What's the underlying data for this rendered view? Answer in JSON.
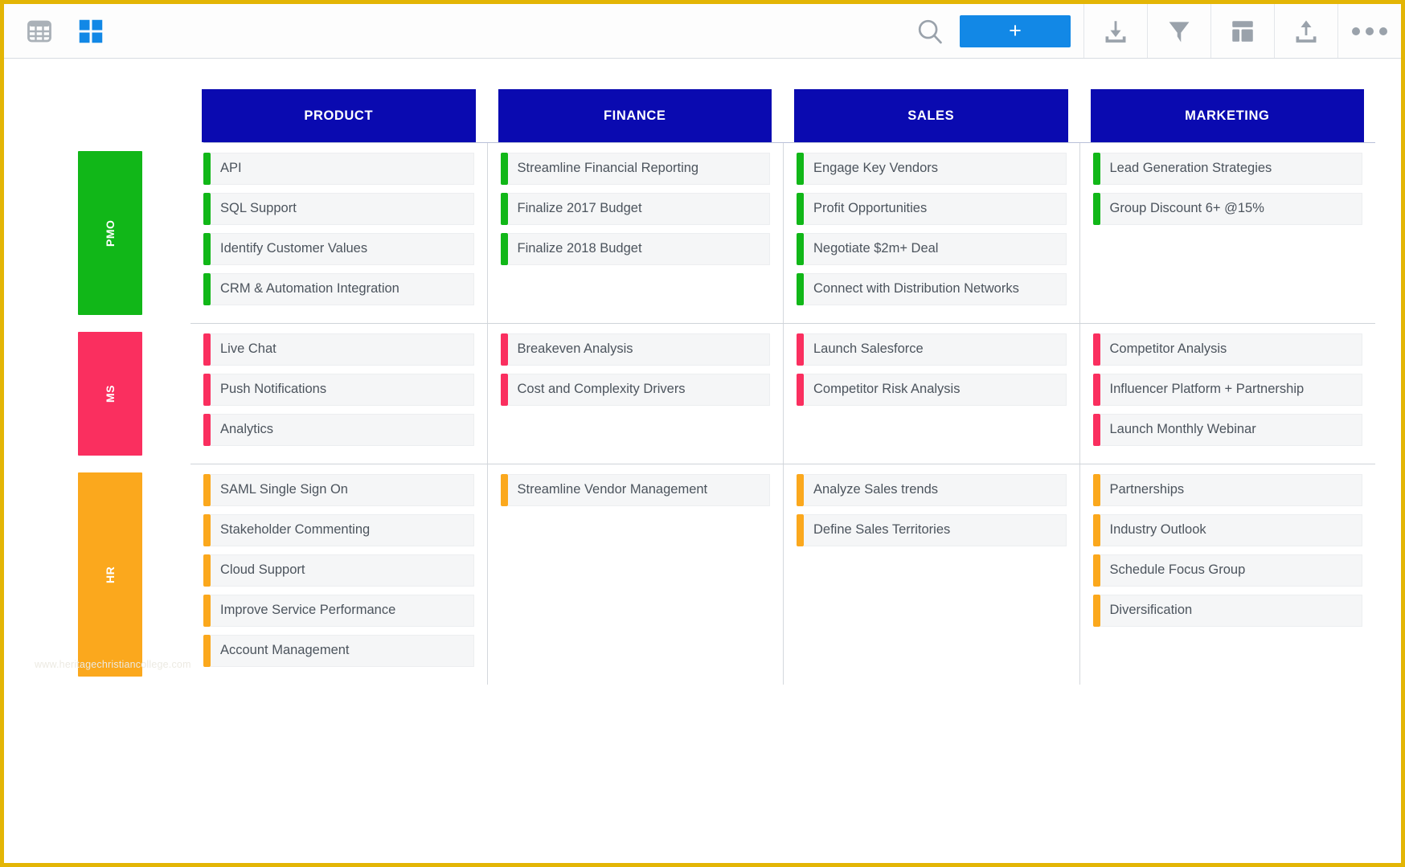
{
  "toolbar": {
    "left_icons": [
      {
        "name": "table-view-icon",
        "label": "Table view"
      },
      {
        "name": "board-view-icon",
        "label": "Board view"
      }
    ],
    "search_label": "Search",
    "add_label": "+",
    "right_icons": [
      {
        "name": "download-icon",
        "label": "Download"
      },
      {
        "name": "filter-icon",
        "label": "Filter"
      },
      {
        "name": "layout-icon",
        "label": "Layout"
      },
      {
        "name": "upload-icon",
        "label": "Upload"
      },
      {
        "name": "more-icon",
        "label": "More options"
      }
    ]
  },
  "colors": {
    "header_blue": "#0a0ab0",
    "accent_blue": "#1288e6",
    "pmo_green": "#11b718",
    "ms_pink": "#fa2f5f",
    "hr_orange": "#fba81d",
    "border_yellow": "#e3b505"
  },
  "columns": [
    {
      "label": "PRODUCT"
    },
    {
      "label": "FINANCE"
    },
    {
      "label": "SALES"
    },
    {
      "label": "MARKETING"
    }
  ],
  "rows": [
    {
      "label": "PMO",
      "color": "#11b718",
      "cells": [
        [
          "API",
          "SQL Support",
          "Identify Customer Values",
          "CRM & Automation Integration"
        ],
        [
          "Streamline Financial Reporting",
          "Finalize 2017 Budget",
          "Finalize 2018 Budget"
        ],
        [
          "Engage Key Vendors",
          "Profit Opportunities",
          "Negotiate $2m+ Deal",
          "Connect with Distribution Networks"
        ],
        [
          "Lead Generation Strategies",
          "Group Discount 6+ @15%"
        ]
      ]
    },
    {
      "label": "MS",
      "color": "#fa2f5f",
      "cells": [
        [
          "Live Chat",
          "Push Notifications",
          "Analytics"
        ],
        [
          "Breakeven Analysis",
          "Cost and Complexity Drivers"
        ],
        [
          "Launch Salesforce",
          "Competitor Risk Analysis"
        ],
        [
          "Competitor Analysis",
          "Influencer Platform + Partnership",
          "Launch Monthly Webinar"
        ]
      ]
    },
    {
      "label": "HR",
      "color": "#fba81d",
      "cells": [
        [
          "SAML Single Sign On",
          "Stakeholder Commenting",
          "Cloud Support",
          "Improve Service Performance",
          "Account Management"
        ],
        [
          "Streamline Vendor Management"
        ],
        [
          "Analyze Sales trends",
          "Define Sales Territories"
        ],
        [
          "Partnerships",
          "Industry Outlook",
          "Schedule Focus Group",
          "Diversification"
        ]
      ]
    }
  ],
  "watermark": "www.heritagechristiancollege.com"
}
